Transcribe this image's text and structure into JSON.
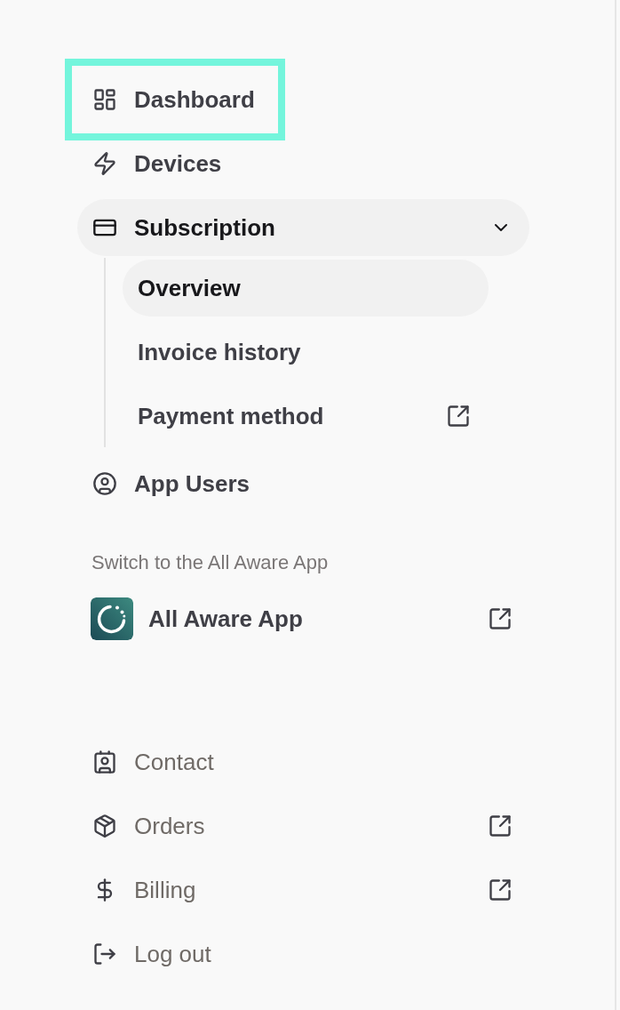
{
  "primary_nav": [
    {
      "label": "Dashboard",
      "selected": false,
      "focused": true
    },
    {
      "label": "Devices",
      "selected": false,
      "focused": false
    },
    {
      "label": "Subscription",
      "selected": true,
      "focused": false,
      "expanded": true,
      "children": [
        {
          "label": "Overview",
          "selected": true,
          "external": false
        },
        {
          "label": "Invoice history",
          "selected": false,
          "external": false
        },
        {
          "label": "Payment method",
          "selected": false,
          "external": true
        }
      ]
    },
    {
      "label": "App Users",
      "selected": false,
      "focused": false
    }
  ],
  "switch_section": {
    "heading": "Switch to the All Aware App",
    "app": {
      "label": "All Aware App",
      "external": true
    }
  },
  "secondary_nav": [
    {
      "label": "Contact",
      "external": false
    },
    {
      "label": "Orders",
      "external": true
    },
    {
      "label": "Billing",
      "external": true
    },
    {
      "label": "Log out",
      "external": false
    }
  ]
}
